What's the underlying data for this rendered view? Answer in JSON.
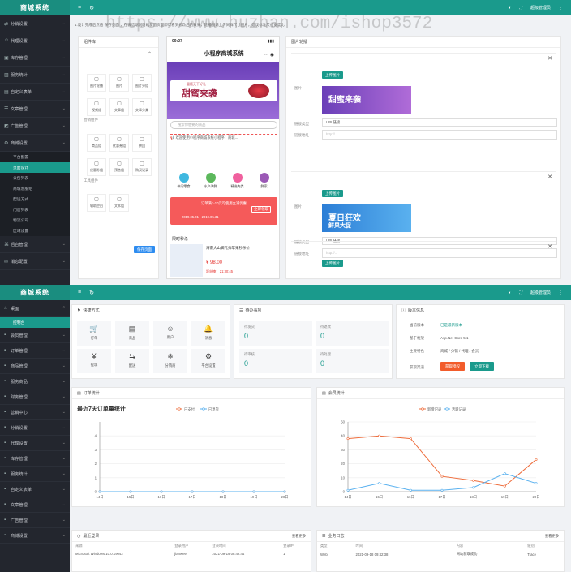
{
  "watermark": "https://www.huzhan.com/ishop3572",
  "top": {
    "logo": "商城系统",
    "user": "超级管理员",
    "nav_items": [
      {
        "label": "分销设置",
        "icon": "share-icon"
      },
      {
        "label": "代理设置",
        "icon": "users-icon"
      },
      {
        "label": "库存管理",
        "icon": "box-icon"
      },
      {
        "label": "服务统计",
        "icon": "stats-icon"
      },
      {
        "label": "自定义表单",
        "icon": "form-icon"
      },
      {
        "label": "文章管理",
        "icon": "doc-icon"
      },
      {
        "label": "广告管理",
        "icon": "ad-icon"
      },
      {
        "label": "商城设置",
        "icon": "gear-icon"
      }
    ],
    "sub_items": [
      "平台配置",
      "页面设计",
      "公告列表",
      "商城客服组",
      "配送方式",
      "门店列表",
      "物流公司",
      "区域设置"
    ],
    "nav_bottom": [
      {
        "label": "后台管理",
        "icon": "admin-icon"
      },
      {
        "label": "消息配置",
        "icon": "msg-icon"
      }
    ],
    "tip": "1.设计完成后点击“保存页面”，在微信端同时刷新首页面即可看到修改后的效果，轮播图请上传同样尺寸图片，建议标准尺寸宽度比例在750×352",
    "components_title": "组件库",
    "comp_row1": [
      "图片轮播",
      "图片",
      "图片分组"
    ],
    "comp_row2": [
      "视频组",
      "文章组",
      "文章分类"
    ],
    "marketing_title": "营销组件",
    "comp_row3": [
      "商品组",
      "优惠券组",
      "拼团"
    ],
    "comp_row4": [
      "优惠券组",
      "预售组",
      "购买记录"
    ],
    "tool_title": "工具组件",
    "comp_row5": [
      "辅助空白",
      "文本组"
    ],
    "save_btn": "保存页面",
    "phone_time": "09:27",
    "phone_title": "小程序商城系统",
    "banner_small": "量贩天下好礼",
    "banner_text": "甜蜜来袭",
    "search_placeholder": "搜索你想要的商品",
    "notice": "欢迎使用小程序商城系统小程序！商城...",
    "cats": [
      "休闲零食",
      "水产海鲜",
      "精选肉类",
      "鲜家"
    ],
    "coupon_title": "订单满1-10元可使用立减优惠",
    "coupon_date": "2019.05.01 - 2019.05.31",
    "coupon_btn": "立即领取",
    "flash_title": "限时秒杀",
    "product_name": "海南大山脚元帅苹果秒杀价",
    "product_price": "¥ 98.00",
    "product_time": "距结束：21:30:45",
    "edit_labels": [
      "编辑",
      "删除"
    ],
    "right_title": "图片轮播",
    "upload_btn": "上传图片",
    "img_label": "图片",
    "link_type": "链接类型",
    "link_addr": "链接地址",
    "link_select": "URL链接",
    "link_placeholder": "http://...",
    "banner2_text": "夏日狂欢",
    "banner2_sub": "鲜果大促"
  },
  "bottom": {
    "logo": "商城系统",
    "user": "超级管理员",
    "home": "桌面",
    "home_sub": "控制台",
    "nav_items": [
      "会员管理",
      "订单管理",
      "商品管理",
      "服务商品",
      "财务管理",
      "营销中心",
      "分销设置",
      "代理设置",
      "库存管理",
      "服务统计",
      "自定义表单",
      "文章管理",
      "广告管理",
      "商城设置"
    ],
    "quick_title": "快捷方式",
    "quick_items": [
      "订单",
      "商品",
      "用户",
      "消息",
      "提现",
      "配送",
      "分销商",
      "平台设置"
    ],
    "todo_title": "待办事项",
    "todo": [
      {
        "label": "待发货",
        "value": "0"
      },
      {
        "label": "待退款",
        "value": "0"
      },
      {
        "label": "待审核",
        "value": "0"
      },
      {
        "label": "待处理",
        "value": "0"
      }
    ],
    "version_title": "版本信息",
    "version": [
      {
        "label": "当前版本",
        "value": "已是最新版本"
      },
      {
        "label": "基于框架",
        "value": "Asp.Net Core 5.1"
      },
      {
        "label": "主要特色",
        "value": "商城 / 分销 / 代理 / 会员"
      }
    ],
    "get_label": "获取渠道",
    "btn_buy": "获取授权",
    "btn_download": "立即下载",
    "order_title": "订单统计",
    "user_title": "会员统计",
    "login_title": "最近登录",
    "log_title": "业务日志",
    "more": "查看更多",
    "login_headers": [
      "来源",
      "登录用户",
      "登录时间",
      "登录IP"
    ],
    "login_row": [
      "Microsoft Windows 10.0.19042",
      "jianwee",
      "2021-09-19 08:42:44",
      "1"
    ],
    "log_headers": [
      "类型",
      "时间",
      "内容",
      "级别"
    ],
    "log_row": [
      "Web",
      "2021-09-18 09:42:38",
      "网站获取成功",
      "Trace"
    ]
  },
  "chart_data": [
    {
      "type": "line",
      "title": "最近7天订单量统计",
      "x": [
        "14日",
        "15日",
        "16日",
        "17日",
        "18日",
        "19日",
        "20日"
      ],
      "ylim": [
        0,
        5
      ],
      "yticks": [
        0,
        1,
        2,
        3,
        4
      ],
      "series": [
        {
          "name": "已支付",
          "color": "#ee6c3b",
          "values": [
            0,
            0,
            0,
            0,
            0,
            0,
            0
          ]
        },
        {
          "name": "已退货",
          "color": "#5ab1ef",
          "values": [
            0,
            0,
            0,
            0,
            0,
            0,
            0
          ]
        }
      ]
    },
    {
      "type": "line",
      "x": [
        "14日",
        "15日",
        "16日",
        "17日",
        "18日",
        "19日",
        "20日"
      ],
      "ylim": [
        0,
        50
      ],
      "yticks": [
        0,
        10,
        20,
        30,
        40,
        50
      ],
      "series": [
        {
          "name": "新增记录",
          "color": "#ee6c3b",
          "values": [
            38,
            40,
            38,
            11,
            8,
            4,
            23
          ]
        },
        {
          "name": "活跃记录",
          "color": "#5ab1ef",
          "values": [
            1,
            6,
            1,
            1,
            3,
            13,
            6
          ]
        }
      ]
    }
  ]
}
